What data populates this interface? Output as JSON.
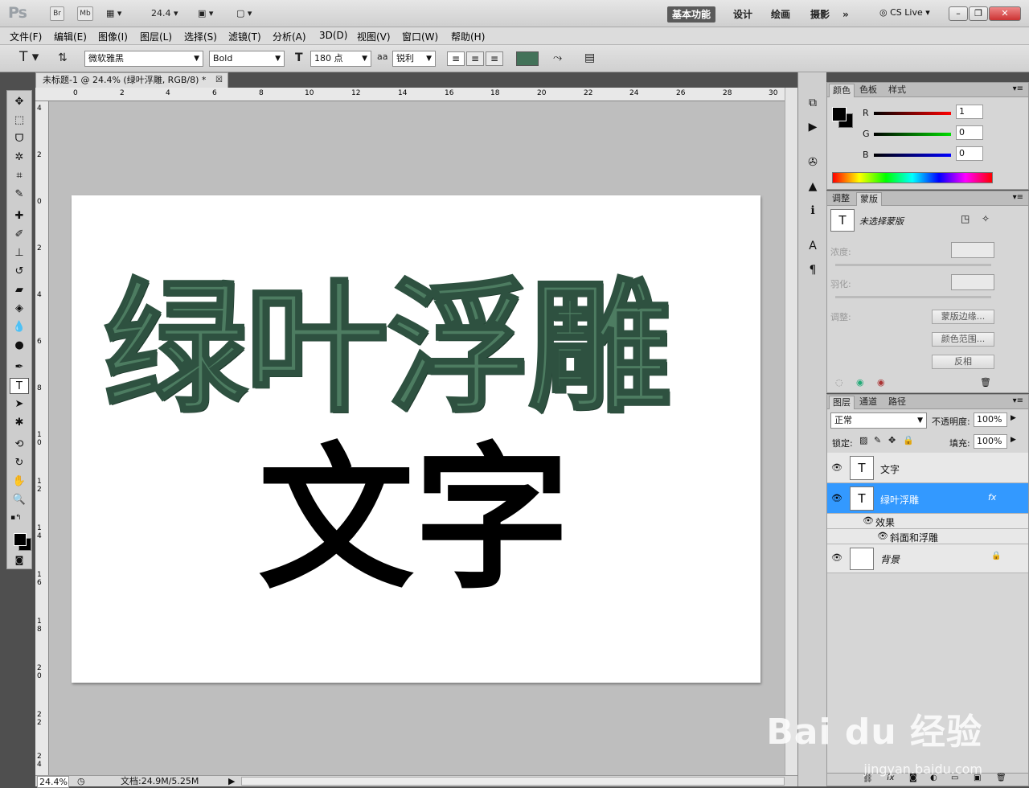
{
  "app": {
    "logo": "Ps",
    "br": "Br",
    "mb": "Mb",
    "zoom": "24.4"
  },
  "workspace": {
    "active": "基本功能",
    "items": [
      "设计",
      "绘画",
      "摄影"
    ],
    "more": "»",
    "cslive": "CS Live"
  },
  "menu": [
    "文件(F)",
    "编辑(E)",
    "图像(I)",
    "图层(L)",
    "选择(S)",
    "滤镜(T)",
    "分析(A)",
    "3D(D)",
    "视图(V)",
    "窗口(W)",
    "帮助(H)"
  ],
  "options": {
    "font_family": "微软雅黑",
    "font_style": "Bold",
    "font_size": "180 点",
    "aa_label": "aa",
    "anti_alias": "锐利",
    "text_color": "#437259"
  },
  "document": {
    "tab_title": "未标题-1 @ 24.4% (绿叶浮雕, RGB/8) *",
    "line1": "绿叶浮雕",
    "line2": "文字",
    "ruler_top": [
      "0",
      "2",
      "4",
      "6",
      "8",
      "10",
      "12",
      "14",
      "16",
      "18",
      "20",
      "22",
      "24",
      "26",
      "28",
      "30"
    ],
    "ruler_left": [
      "4",
      "2",
      "0",
      "2",
      "4",
      "6",
      "8",
      "1 0",
      "1 2",
      "1 4",
      "1 6",
      "1 8",
      "2 0",
      "2 2",
      "2 4"
    ]
  },
  "status": {
    "zoom": "24.4%",
    "doc_size": "文档:24.9M/5.25M"
  },
  "color_panel": {
    "tabs": [
      "颜色",
      "色板",
      "样式"
    ],
    "channels": [
      {
        "label": "R",
        "value": "1"
      },
      {
        "label": "G",
        "value": "0"
      },
      {
        "label": "B",
        "value": "0"
      }
    ]
  },
  "masks_panel": {
    "tabs": [
      "调整",
      "蒙版"
    ],
    "no_selection": "未选择蒙版",
    "density": "浓度:",
    "feather": "羽化:",
    "adjust": "调整:",
    "btn_edge": "蒙版边缘...",
    "btn_range": "颜色范围...",
    "btn_invert": "反相"
  },
  "layers_panel": {
    "tabs": [
      "图层",
      "通道",
      "路径"
    ],
    "blend_mode": "正常",
    "opacity_label": "不透明度:",
    "opacity": "100%",
    "lock_label": "锁定:",
    "fill_label": "填充:",
    "fill": "100%",
    "layers": [
      {
        "name": "文字"
      },
      {
        "name": "绿叶浮雕",
        "fx": "fx"
      },
      {
        "name": "效果"
      },
      {
        "name": "斜面和浮雕"
      },
      {
        "name": "背景"
      }
    ]
  },
  "watermark": {
    "logo": "Bai du 经验",
    "url": "jingyan.baidu.com"
  }
}
